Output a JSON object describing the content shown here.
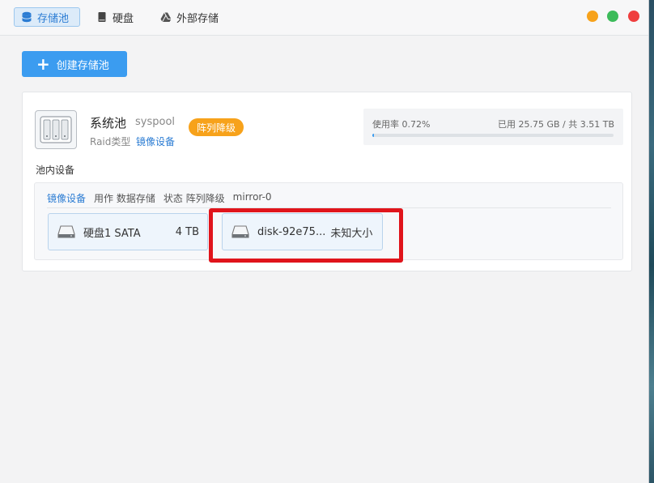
{
  "tabs": [
    {
      "label": "存储池",
      "icon": "database-icon",
      "active": true
    },
    {
      "label": "硬盘",
      "icon": "harddrive-icon",
      "active": false
    },
    {
      "label": "外部存储",
      "icon": "cloud-drive-icon",
      "active": false
    }
  ],
  "window_controls": {
    "minimize_color": "#f7a21b",
    "maximize_color": "#3cbb5a",
    "close_color": "#ef3e3e"
  },
  "toolbar": {
    "create_label": "创建存储池",
    "create_icon": "plus-icon"
  },
  "pool": {
    "name": "系统池",
    "id": "syspool",
    "raid_label": "Raid类型",
    "raid_value": "镜像设备",
    "status_badge": "阵列降级",
    "usage_text": "使用率 0.72%",
    "usage_percent": 0.72,
    "capacity_text": "已用 25.75 GB / 共 3.51 TB"
  },
  "devices": {
    "title": "池内设备",
    "header": {
      "type_link": "镜像设备",
      "usage": "用作 数据存储",
      "state": "状态 阵列降级",
      "name": "mirror-0"
    },
    "disks": [
      {
        "label": "硬盘1 SATA",
        "size": "4 TB"
      },
      {
        "label": "disk-92e75...",
        "size": "未知大小"
      }
    ]
  },
  "colors": {
    "accent": "#3b9cf0",
    "warning": "#f7a21b",
    "highlight": "#e0141b"
  }
}
